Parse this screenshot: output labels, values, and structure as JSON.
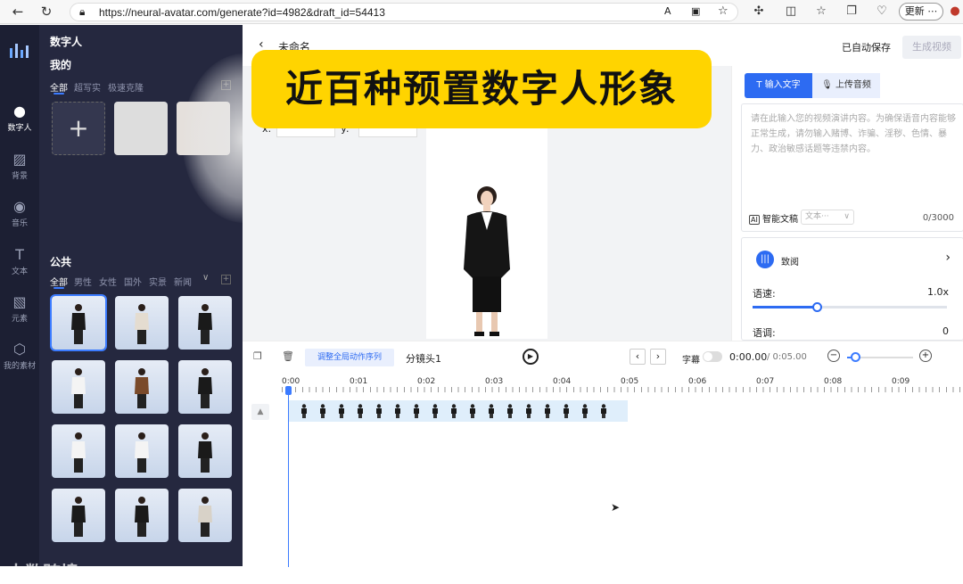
{
  "browser": {
    "url": "https://neural-avatar.com/generate?id=4982&draft_id=54413",
    "update_label": "更新",
    "more_label": "⋯"
  },
  "rail": {
    "logo_icon": "bars-logo-icon",
    "items": [
      {
        "label": "数字人",
        "icon": "person-icon",
        "active": true
      },
      {
        "label": "背景",
        "icon": "slash-box-icon"
      },
      {
        "label": "音乐",
        "icon": "disc-icon"
      },
      {
        "label": "文本",
        "icon": "text-t-icon"
      },
      {
        "label": "元素",
        "icon": "image-icon"
      },
      {
        "label": "我的素材",
        "icon": "cube-icon"
      }
    ]
  },
  "panel": {
    "title": "数字人",
    "mine_heading": "我的",
    "mine_tabs": [
      "全部",
      "超写实",
      "极速克隆"
    ],
    "public_heading": "公共",
    "public_tabs": [
      "全部",
      "男性",
      "女性",
      "国外",
      "实景",
      "新闻"
    ],
    "accent": "#3b7bff"
  },
  "topbar": {
    "title": "未命名",
    "autosave": "已自动保存",
    "generate": "生成视频"
  },
  "banner": {
    "text": "近百种预置数字人形象",
    "color": "#ffd400"
  },
  "canvas": {
    "x_label": "x:",
    "y_label": "y:"
  },
  "right": {
    "tab_text": "输入文字",
    "tab_audio": "上传音频",
    "placeholder": "请在此输入您的视频演讲内容。为确保语音内容能够正常生成，请勿输入赌博、诈骗、淫秽、色情、暴力、政治敏感话题等违禁内容。",
    "ai_label": "智能文稿",
    "ai_select": "文本···",
    "counter": "0/3000",
    "voice_name": "致阅",
    "speed_label": "语速:",
    "speed_value": "1.0x",
    "speed_fraction": 0.33,
    "pitch_label": "语调:",
    "pitch_value": "0"
  },
  "timeline": {
    "global_btn": "调整全局动作序列",
    "shot_name": "分镜头1",
    "subtitle_label": "字幕",
    "current_time": "0:00.00",
    "total_time": "/ 0:05.00",
    "ticks": [
      "0:00",
      "0:01",
      "0:02",
      "0:03",
      "0:04",
      "0:05",
      "0:06",
      "0:07",
      "0:08",
      "0:09"
    ],
    "clip_frames": 17
  },
  "watermark": "大数跨境"
}
